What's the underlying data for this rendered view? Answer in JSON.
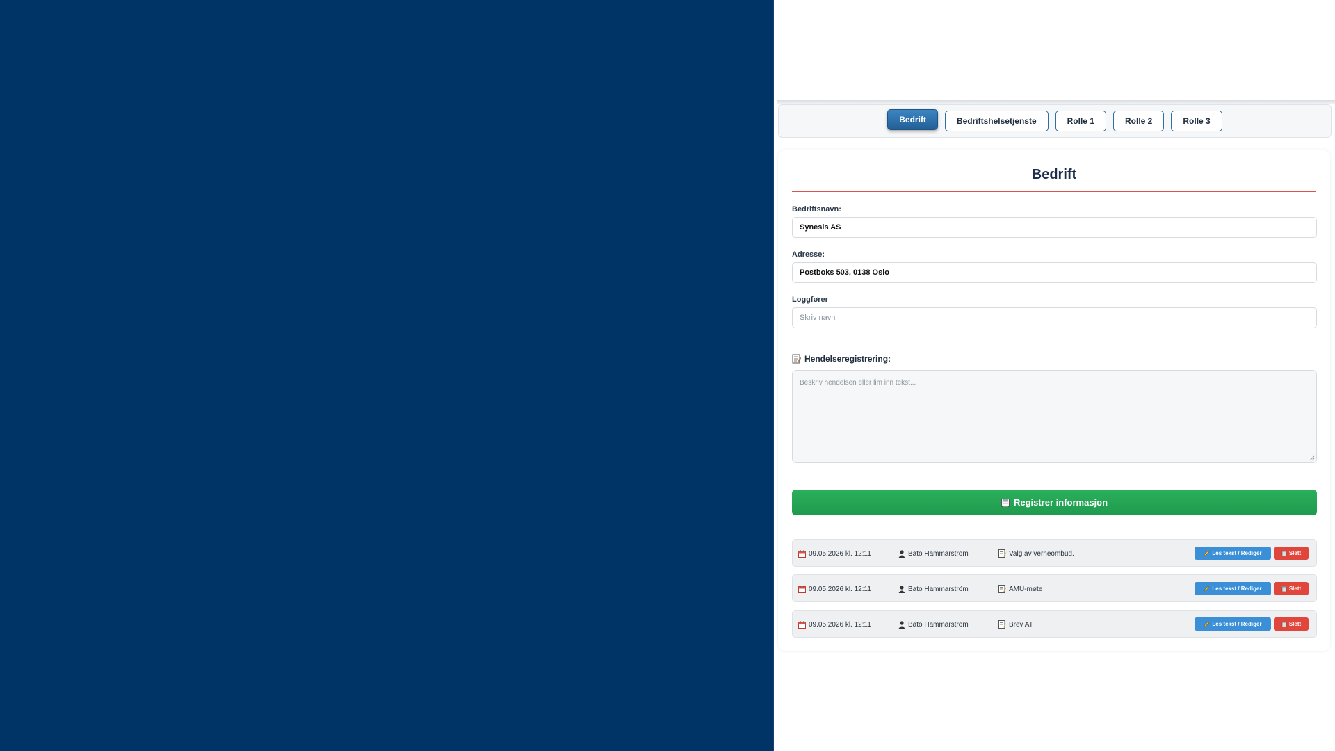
{
  "tabs": [
    {
      "label": "Bedrift",
      "active": true
    },
    {
      "label": "Bedriftshelsetjenste",
      "active": false
    },
    {
      "label": "Rolle 1",
      "active": false
    },
    {
      "label": "Rolle 2",
      "active": false
    },
    {
      "label": "Rolle 3",
      "active": false
    }
  ],
  "form": {
    "title": "Bedrift",
    "company_label": "Bedriftsnavn:",
    "company_value": "Synesis AS",
    "address_label": "Adresse:",
    "address_value": "Postboks 503, 0138 Oslo",
    "logger_label": "Loggfører",
    "logger_placeholder": "Skriv navn",
    "event_label": "Hendelseregistrering:",
    "event_placeholder": "Beskriv hendelsen eller lim inn tekst...",
    "submit_label": "Registrer informasjon"
  },
  "log_entries": [
    {
      "date": "09.05.2026 kl. 12:11",
      "user": "Bato Hammarström",
      "title": "Valg av verneombud."
    },
    {
      "date": "09.05.2026 kl. 12:11",
      "user": "Bato Hammarström",
      "title": "AMU-møte"
    },
    {
      "date": "09.05.2026 kl. 12:11",
      "user": "Bato Hammarström",
      "title": "Brev AT"
    }
  ],
  "row_actions": {
    "edit_label": "Les tekst / Rediger",
    "delete_label": "Slett"
  },
  "colors": {
    "left_panel": "#003366",
    "accent_blue": "#2f6fa3",
    "submit_green": "#23a455",
    "title_underline": "#d9534f",
    "delete_red": "#e0463b",
    "edit_blue": "#3a8fd6"
  },
  "icons": {
    "section": "memo-icon",
    "submit": "floppy-disk-icon",
    "date": "calendar-icon",
    "user": "person-icon",
    "title": "memo-icon",
    "edit": "pencil-icon",
    "delete": "trash-icon"
  }
}
